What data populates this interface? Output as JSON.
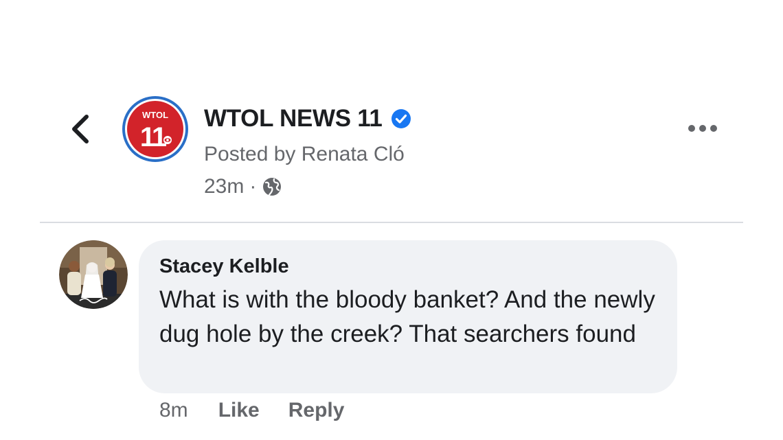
{
  "post_header": {
    "page_name": "WTOL NEWS 11",
    "posted_by": "Posted by Renata Cló",
    "time": "23m",
    "separator": "·",
    "audience_icon": "globe-icon",
    "verified_icon": "verified-badge-icon",
    "logo": {
      "top_text": "WTOL",
      "number": "11",
      "ring_color": "#2a6fc7",
      "fill_color": "#d2232a"
    }
  },
  "comment": {
    "author": "Stacey Kelble",
    "text": "What is with the bloody banket? And the newly dug hole by the creek? That searchers found",
    "time": "8m",
    "like_label": "Like",
    "reply_label": "Reply"
  },
  "colors": {
    "verified_blue": "#1877f2",
    "bubble_bg": "#f0f2f5",
    "secondary_text": "#65676b",
    "primary_text": "#1c1e21"
  },
  "icons": {
    "back": "chevron-left-icon",
    "more": "more-options-icon"
  }
}
